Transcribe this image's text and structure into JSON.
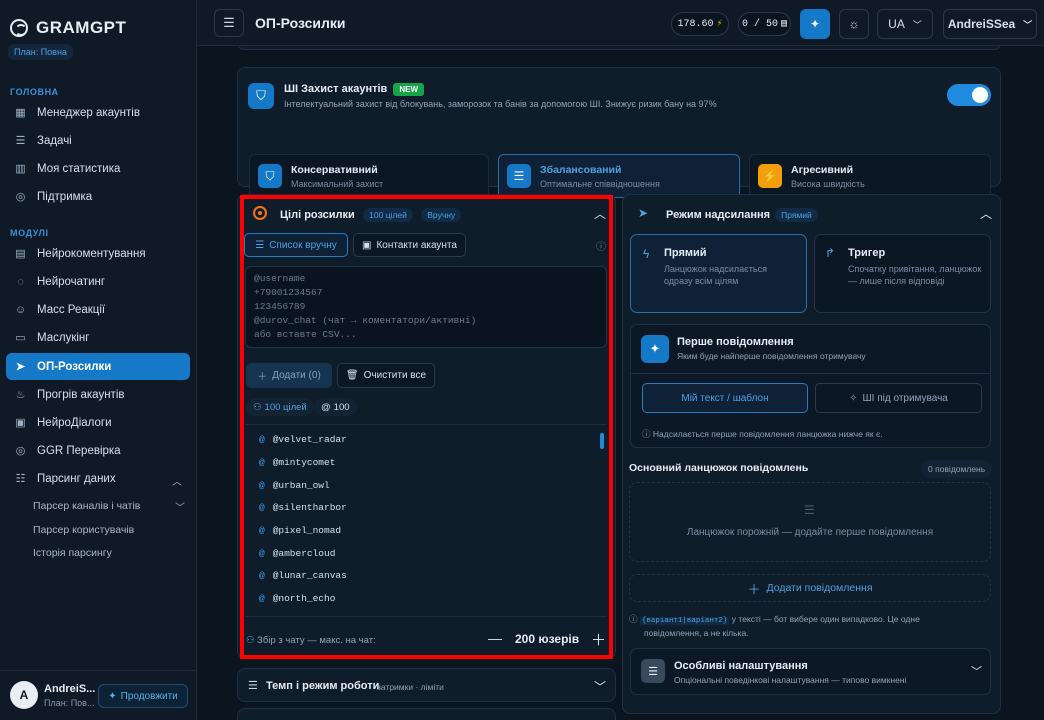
{
  "app": {
    "name": "GRAMGPT",
    "plan": "План: Повна"
  },
  "sidebar": {
    "section_main": "ГОЛОВНА",
    "main_items": [
      {
        "label": "Менеджер акаунтів",
        "icon": "grid-icon"
      },
      {
        "label": "Задачі",
        "icon": "list-icon"
      },
      {
        "label": "Моя статистика",
        "icon": "chart-icon"
      },
      {
        "label": "Підтримка",
        "icon": "globe-icon"
      }
    ],
    "section_modules": "МОДУЛІ",
    "module_items": [
      {
        "label": "Нейрокоментування",
        "icon": "comment-icon"
      },
      {
        "label": "Нейрочатинг",
        "icon": "chat-icon"
      },
      {
        "label": "Масс Реакції",
        "icon": "smile-icon"
      },
      {
        "label": "Маслукінг",
        "icon": "monitor-icon"
      },
      {
        "label": "ОП-Розсилки",
        "icon": "send-icon"
      },
      {
        "label": "Прогрів акаунтів",
        "icon": "flame-icon"
      },
      {
        "label": "НейроДіалоги",
        "icon": "dialog-icon"
      },
      {
        "label": "GGR Перевірка",
        "icon": "globe-icon"
      },
      {
        "label": "Парсинг даних",
        "icon": "database-icon"
      }
    ],
    "sub_items": [
      "Парсер каналів і чатів",
      "Парсер користувачів",
      "Історія парсингу"
    ],
    "user": {
      "avatar": "A",
      "name": "AndreiS...",
      "plan": "План: Пов...",
      "extend_label": "Продовжити"
    }
  },
  "header": {
    "title": "ОП-Розсилки",
    "balance": "178.60",
    "counter": "0 / 50",
    "lang": "UA",
    "username": "AndreiSSea"
  },
  "ai_protection": {
    "title": "ШІ Захист акаунтів",
    "badge": "NEW",
    "description": "Інтелектуальний захист від блокувань, заморозок та банів за допомогою ШІ. Знижує ризик бану на 97%",
    "enabled": true,
    "modes": [
      {
        "title": "Консервативний",
        "subtitle": "Максимальний захист",
        "color": "#1579c8"
      },
      {
        "title": "Збалансований",
        "subtitle": "Оптимальне співвідношення",
        "color": "#1579c8"
      },
      {
        "title": "Агресивний",
        "subtitle": "Висока швидкість",
        "color": "#f59e0b"
      }
    ]
  },
  "targets": {
    "title": "Цілі розсилки",
    "count_badge": "100 цілей",
    "mode_badge": "Вручну",
    "tab_manual": "Список вручну",
    "tab_contacts": "Контакти акаунта",
    "placeholder_lines": [
      "@username",
      "+79001234567",
      "123456789",
      "@durov_chat (чат → коментатори/активні)",
      "або вставте CSV..."
    ],
    "add_label": "Додати (0)",
    "clear_label": "Очистити все",
    "targets_chip": "100 цілей",
    "at_chip": "100",
    "usernames": [
      "@velvet_radar",
      "@mintycomet",
      "@urban_owl",
      "@silentharbor",
      "@pixel_nomad",
      "@ambercloud",
      "@lunar_canvas",
      "@north_echo"
    ],
    "collect_label": "Збір з чату — макс. на чат:",
    "collect_value": "200 юзерів"
  },
  "tempo": {
    "title": "Темп і режим роботи",
    "subtitle": "затримки · ліміти"
  },
  "send_mode": {
    "title": "Режим надсилання",
    "badge": "Прямий",
    "direct_title": "Прямий",
    "direct_sub": "Ланцюжок надсилається одразу всім цілям",
    "trigger_title": "Тригер",
    "trigger_sub": "Спочатку привітання, ланцюжок — лише після відповіді",
    "first_msg_title": "Перше повідомлення",
    "first_msg_sub": "Яким буде найперше повідомлення отримувачу",
    "btn_template": "Мій текст / шаблон",
    "btn_ai": "ШІ під отримувача",
    "first_msg_hint": "Надсилається перше повідомлення ланцюжка нижче як є.",
    "chain_title": "Основний ланцюжок повідомлень",
    "chain_count": "0 повідомлень",
    "chain_empty": "Ланцюжок порожній — додайте перше повідомлення",
    "add_message": "Додати повідомлення",
    "variant_code": "{варіант1|варіант2}",
    "variant_hint_1": "у тексті — бот вибере один випадково. Це одне",
    "variant_hint_2": "повідомлення, а не кілька.",
    "special_title": "Особливі налаштування",
    "special_sub": "Опціональні поведінкові налаштування — типово вимкнені"
  }
}
